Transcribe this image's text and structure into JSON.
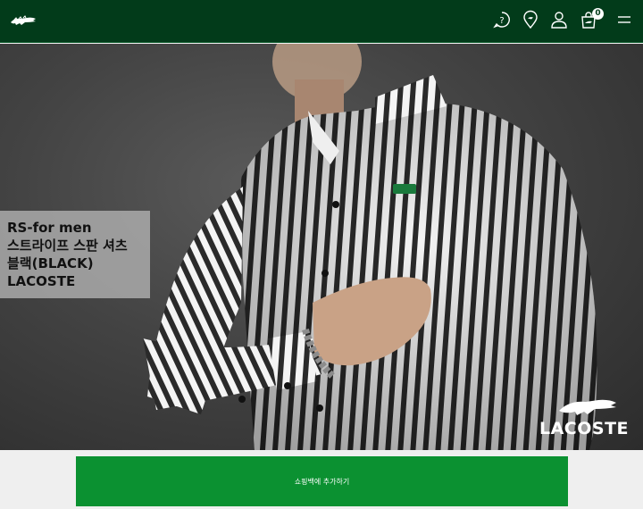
{
  "header": {
    "logo_icon": "crocodile-logo-icon",
    "icons": [
      "help-icon",
      "location-icon",
      "user-icon",
      "shopping-bag-icon",
      "menu-icon"
    ],
    "cart_count": "0",
    "background": "#023b1a"
  },
  "hero": {
    "overlay_lines": [
      "RS-for men",
      "스트라이프 스판 셔츠",
      "블랙(BLACK)",
      "LACOSTE"
    ],
    "brand_text": "LACOSTE"
  },
  "cta": {
    "label": "쇼핑백에 추가하기",
    "color": "#0b9131"
  }
}
